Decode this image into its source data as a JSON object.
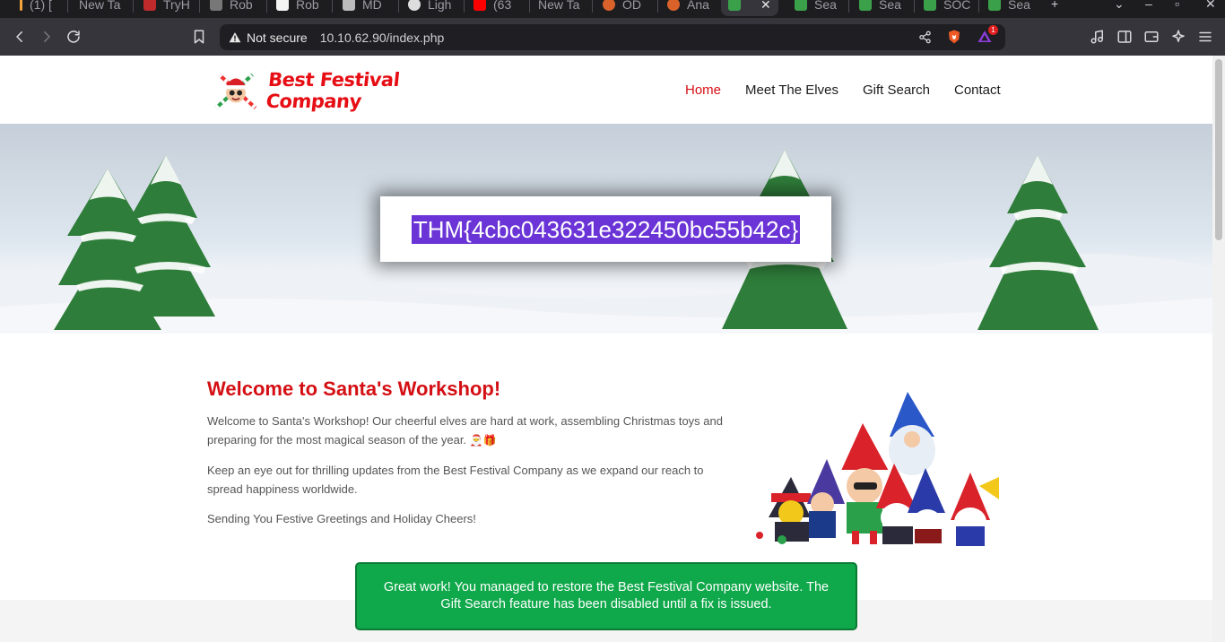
{
  "browser": {
    "tabs": [
      {
        "label": "(1) [",
        "color": "#f2a33a"
      },
      {
        "label": "New Ta",
        "color": ""
      },
      {
        "label": "TryH",
        "color": "#c02a2a"
      },
      {
        "label": "Rob",
        "color": "#888"
      },
      {
        "label": "Rob",
        "color": "#ffffff"
      },
      {
        "label": "MD",
        "color": "#cccccc"
      },
      {
        "label": "Ligh",
        "color": "#dddddd"
      },
      {
        "label": "(63",
        "color": "#ff0000"
      },
      {
        "label": "New Ta",
        "color": ""
      },
      {
        "label": "OD",
        "color": "#d9622b"
      },
      {
        "label": "Ana",
        "color": "#d9622b"
      },
      {
        "label": "",
        "color": "#3aa14a",
        "active": true
      },
      {
        "label": "Sea",
        "color": "#3aa14a"
      },
      {
        "label": "Sea",
        "color": "#3aa14a"
      },
      {
        "label": "SOC",
        "color": "#3aa14a"
      },
      {
        "label": "Sea",
        "color": "#3aa14a"
      }
    ],
    "security_label": "Not secure",
    "url": "10.10.62.90/index.php",
    "notification_count": "1"
  },
  "site": {
    "logo_text": "Best Festival Company",
    "nav": {
      "home": "Home",
      "elves": "Meet The Elves",
      "gift": "Gift Search",
      "contact": "Contact"
    },
    "flag": "THM{4cbc043631e322450bc55b42c}",
    "welcome_title": "Welcome to Santa's Workshop!",
    "paragraph1": "Welcome to Santa's Workshop! Our cheerful elves are hard at work, assembling Christmas toys and preparing for the most magical season of the year.",
    "paragraph1_emoji": "🎅🎁",
    "paragraph2": "Keep an eye out for thrilling updates from the Best Festival Company as we expand our reach to spread happiness worldwide.",
    "paragraph3": "Sending You Festive Greetings and Holiday Cheers!",
    "toast": "Great work! You managed to restore the Best Festival Company website. The Gift Search feature has been disabled until a fix is issued."
  },
  "colors": {
    "accent_red": "#d40f14",
    "toast_green": "#0fa84a",
    "flag_highlight": "#6b34d6"
  }
}
